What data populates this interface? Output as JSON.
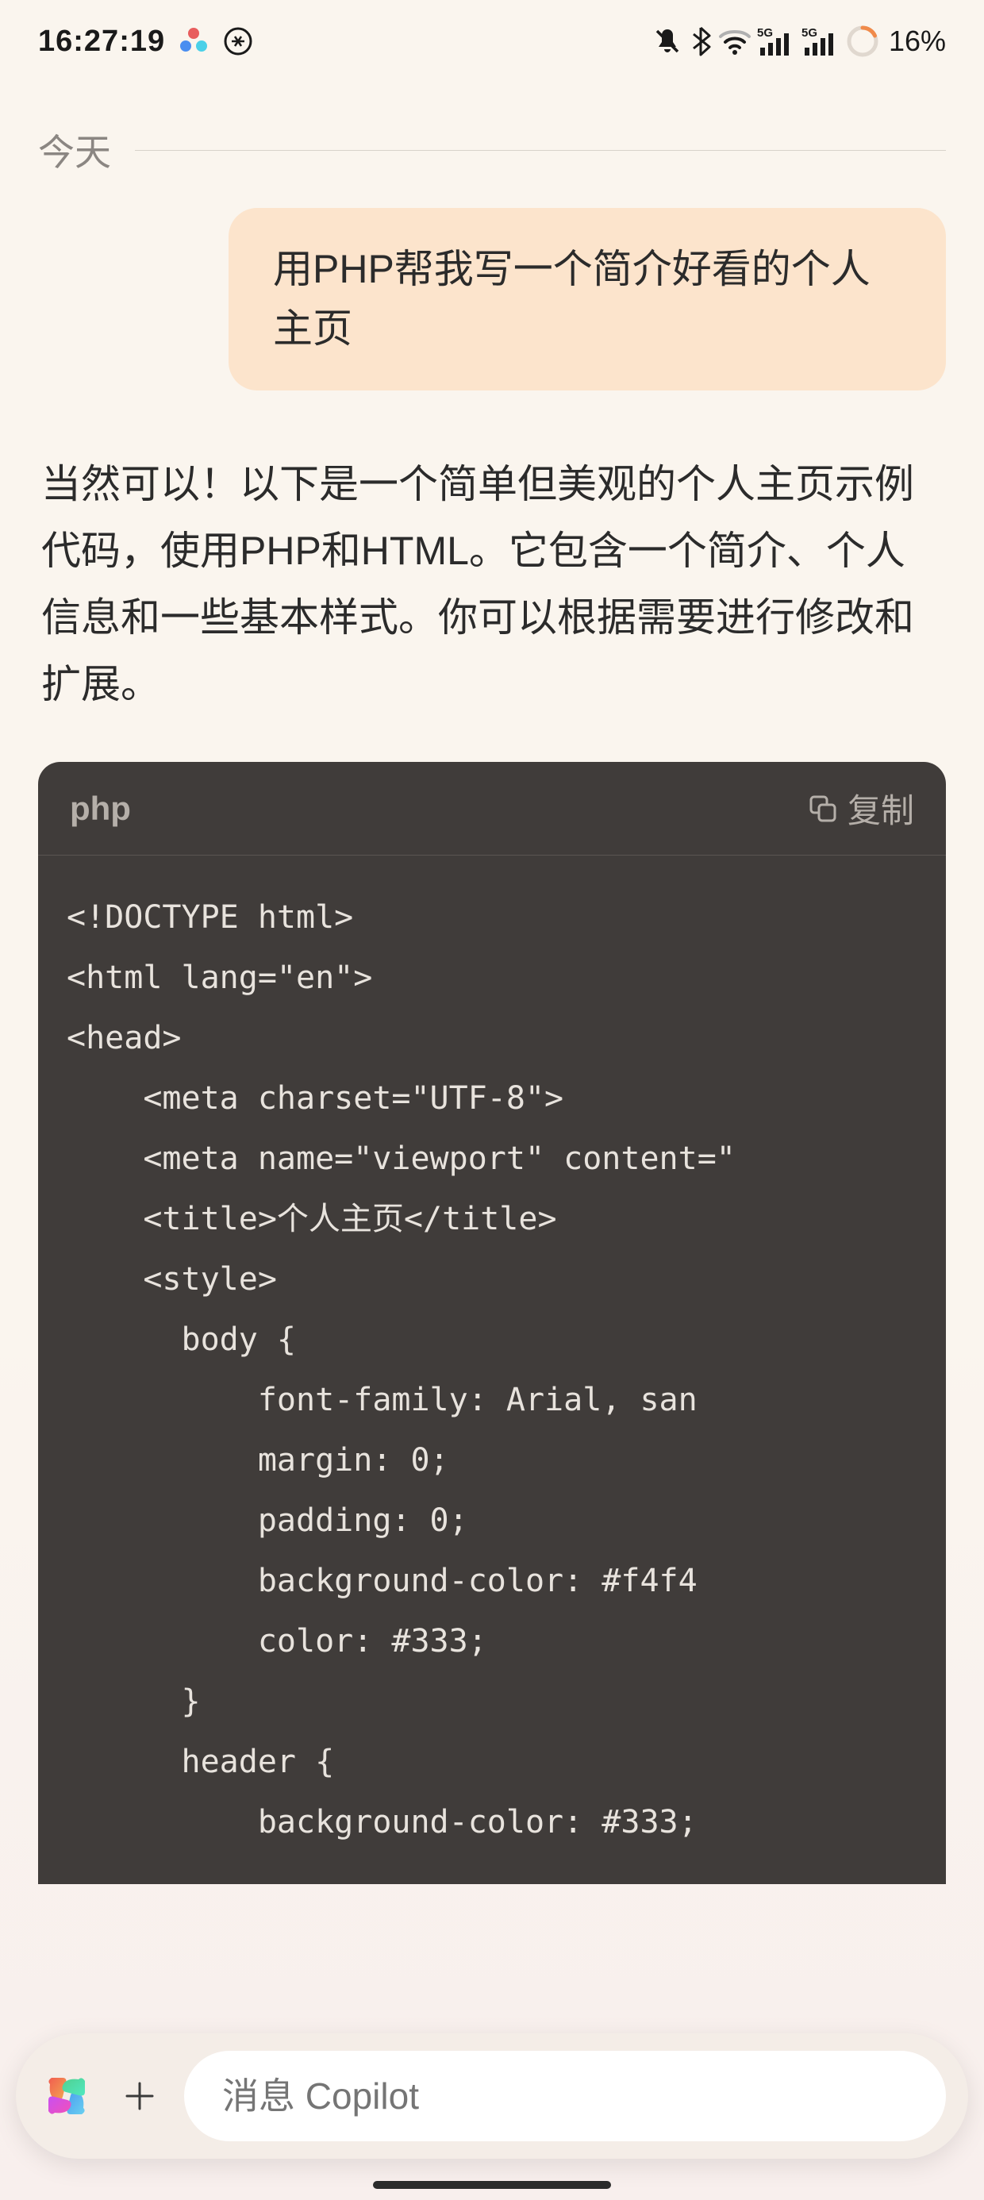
{
  "status": {
    "time": "16:27:19",
    "battery": "16%"
  },
  "date_label": "今天",
  "user_message": "用PHP帮我写一个简介好看的个人主页",
  "assistant_intro": "当然可以！以下是一个简单但美观的个人主页示例代码，使用PHP和HTML。它包含一个简介、个人信息和一些基本样式。你可以根据需要进行修改和扩展。",
  "code": {
    "language": "php",
    "copy_label": "复制",
    "content": "<!DOCTYPE html>\n<html lang=\"en\">\n<head>\n    <meta charset=\"UTF-8\">\n    <meta name=\"viewport\" content=\"\n    <title>个人主页</title>\n    <style>\n      body {\n          font-family: Arial, san\n          margin: 0;\n          padding: 0;\n          background-color: #f4f4\n          color: #333;\n      }\n      header {\n          background-color: #333;"
  },
  "input": {
    "placeholder": "消息 Copilot"
  }
}
